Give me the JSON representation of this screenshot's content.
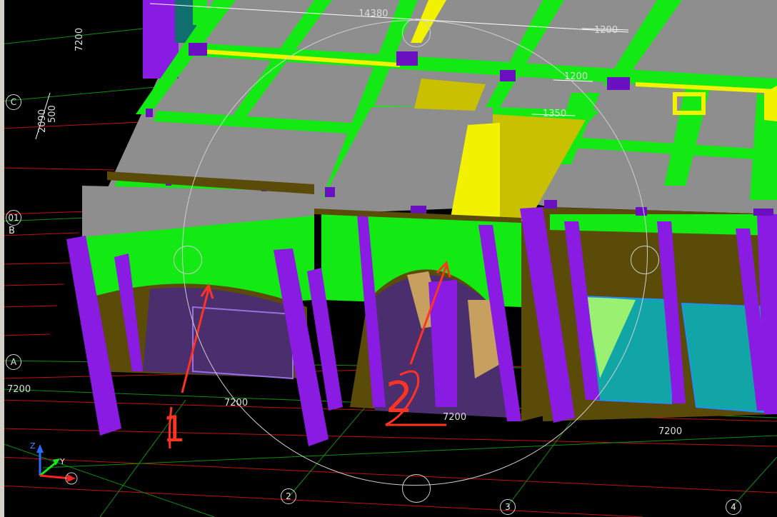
{
  "grid": {
    "rows": {
      "c": "C",
      "o1": "01",
      "b": "B",
      "a": "A"
    },
    "cols": {
      "c2": "2",
      "c3": "3",
      "c4": "4"
    }
  },
  "dims": {
    "top_span": "14380",
    "top_right_a": "1200",
    "top_right_b": "1200",
    "mid_a": "1350",
    "left_vertical": "7200",
    "left_2090": "2090",
    "left_500": "500",
    "left_7200_row": "7200",
    "bay1": "7200",
    "bay2": "7200",
    "bay3": "7200"
  },
  "annotations": {
    "mark_1": "1",
    "mark_2": "2"
  },
  "axes": {
    "z": "Z",
    "y": "Y",
    "x": "X"
  },
  "colors": {
    "background": "#000000",
    "slab": "#8e8e8e",
    "beam": "#13ea14",
    "column": "#8a1be2",
    "wall": "#5a4b08",
    "highlight": "#f2f200",
    "glass": "#12a5a5",
    "annotation": "#ff3322",
    "grid_red": "#c01010",
    "grid_green": "#0e8f0e"
  }
}
